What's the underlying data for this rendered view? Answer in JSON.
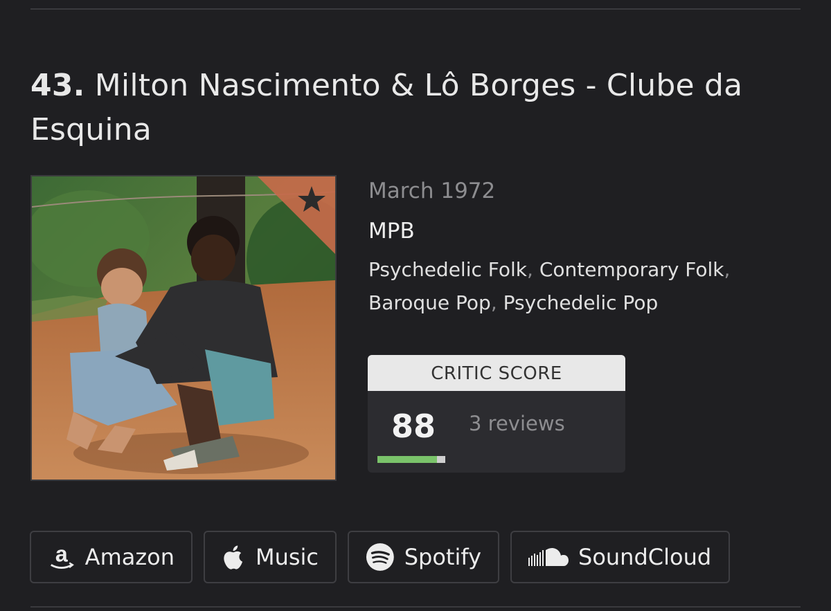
{
  "list_entry": {
    "rank": "43.",
    "title": "Milton Nascimento & Lô Borges - Clube da Esquina"
  },
  "album": {
    "release_date": "March 1972",
    "primary_genre": "MPB",
    "secondary_genres": [
      "Psychedelic Folk",
      "Contemporary Folk",
      "Baroque Pop",
      "Psychedelic Pop"
    ],
    "separator": ","
  },
  "critic": {
    "header": "CRITIC SCORE",
    "score": "88",
    "reviews": "3 reviews",
    "score_fraction": 0.88,
    "bar_color": "#7ac36a"
  },
  "buy_links": [
    {
      "label": "Amazon",
      "icon": "amazon-icon"
    },
    {
      "label": "Music",
      "icon": "apple-icon"
    },
    {
      "label": "Spotify",
      "icon": "spotify-icon"
    },
    {
      "label": "SoundCloud",
      "icon": "soundcloud-icon"
    }
  ],
  "colors": {
    "background": "#1f1f22",
    "flag": "#c56a4a"
  }
}
